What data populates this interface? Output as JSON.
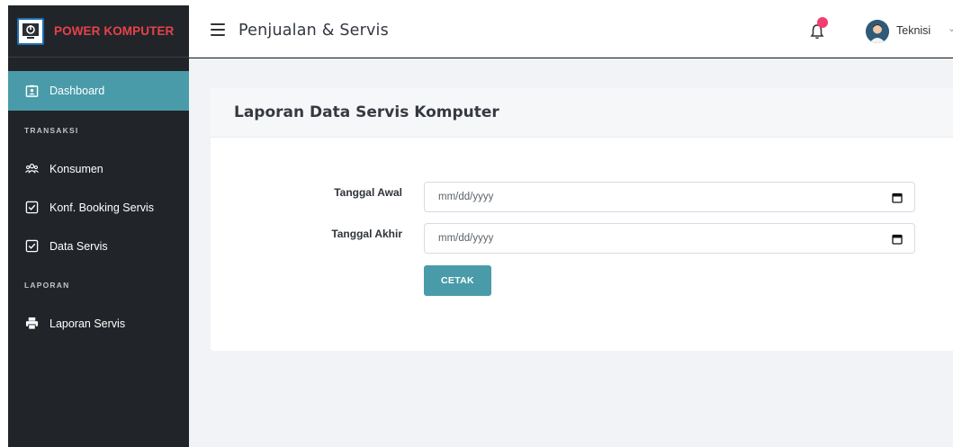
{
  "brand": {
    "name": "POWER KOMPUTER",
    "logo_icon": "power-monitor-icon",
    "color": "#e8414a"
  },
  "header": {
    "title": "Penjualan & Servis",
    "user_name": "Teknisi",
    "menu_icon": "hamburger-icon",
    "notification_icon": "bell-icon",
    "notification_dot_color": "#f53d73"
  },
  "sidebar": {
    "accent_color": "#4a9ba9",
    "items": [
      {
        "type": "link",
        "label": "Dashboard",
        "icon": "id-card-icon",
        "active": true
      },
      {
        "type": "heading",
        "label": "TRANSAKSI"
      },
      {
        "type": "link",
        "label": "Konsumen",
        "icon": "users-icon",
        "active": false
      },
      {
        "type": "link",
        "label": "Konf. Booking Servis",
        "icon": "checkbox-icon",
        "active": false
      },
      {
        "type": "link",
        "label": "Data Servis",
        "icon": "checkbox-icon",
        "active": false
      },
      {
        "type": "heading",
        "label": "LAPORAN"
      },
      {
        "type": "link",
        "label": "Laporan Servis",
        "icon": "printer-icon",
        "active": false
      }
    ]
  },
  "main": {
    "card_title": "Laporan Data Servis Komputer",
    "form": {
      "start_label": "Tanggal Awal",
      "start_value": "mm/dd/yyyy",
      "end_label": "Tanggal Akhir",
      "end_value": "mm/dd/yyyy",
      "submit_label": "CETAK"
    }
  }
}
